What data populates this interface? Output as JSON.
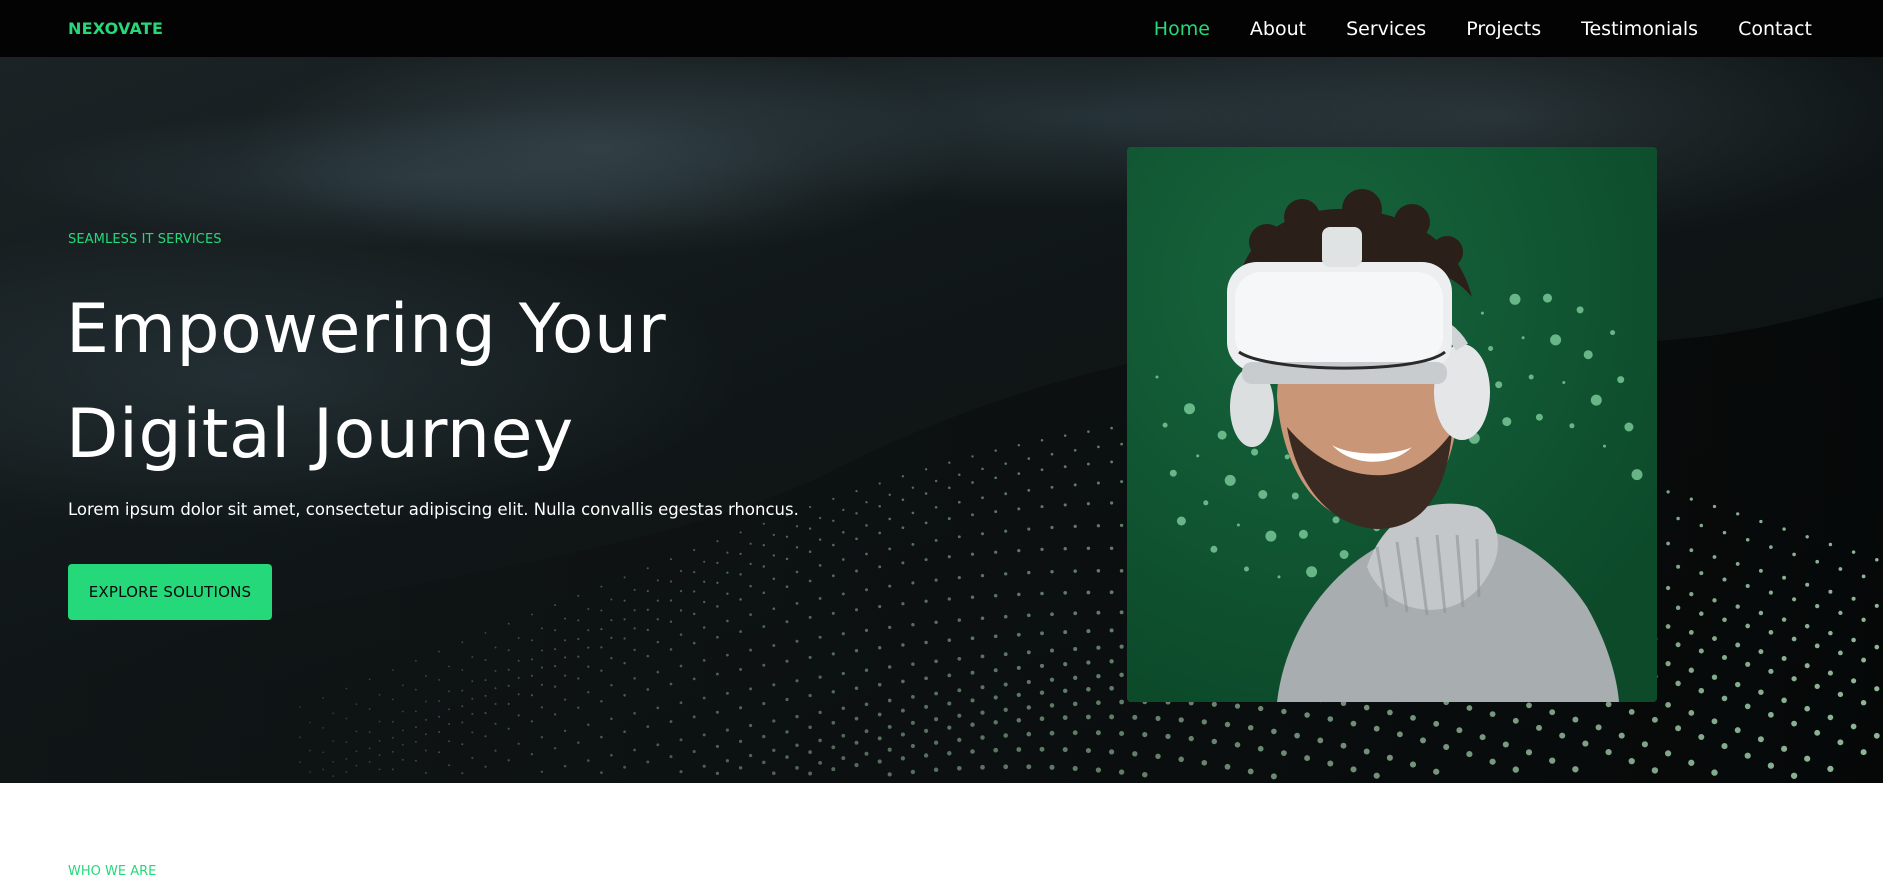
{
  "brand": {
    "name": "NEXOVATE",
    "accent": "#25d97a"
  },
  "nav": {
    "items": [
      {
        "label": "Home",
        "active": true
      },
      {
        "label": "About",
        "active": false
      },
      {
        "label": "Services",
        "active": false
      },
      {
        "label": "Projects",
        "active": false
      },
      {
        "label": "Testimonials",
        "active": false
      },
      {
        "label": "Contact",
        "active": false
      }
    ]
  },
  "hero": {
    "eyebrow": "SEAMLESS IT SERVICES",
    "title_line1": "Empowering Your",
    "title_line2": "Digital Journey",
    "description": "Lorem ipsum dolor sit amet, consectetur adipiscing elit. Nulla convallis egestas rhoncus.",
    "cta_label": "EXPLORE SOLUTIONS",
    "image": "person-wearing-vr-headset-photo"
  },
  "about": {
    "eyebrow": "WHO WE ARE"
  }
}
